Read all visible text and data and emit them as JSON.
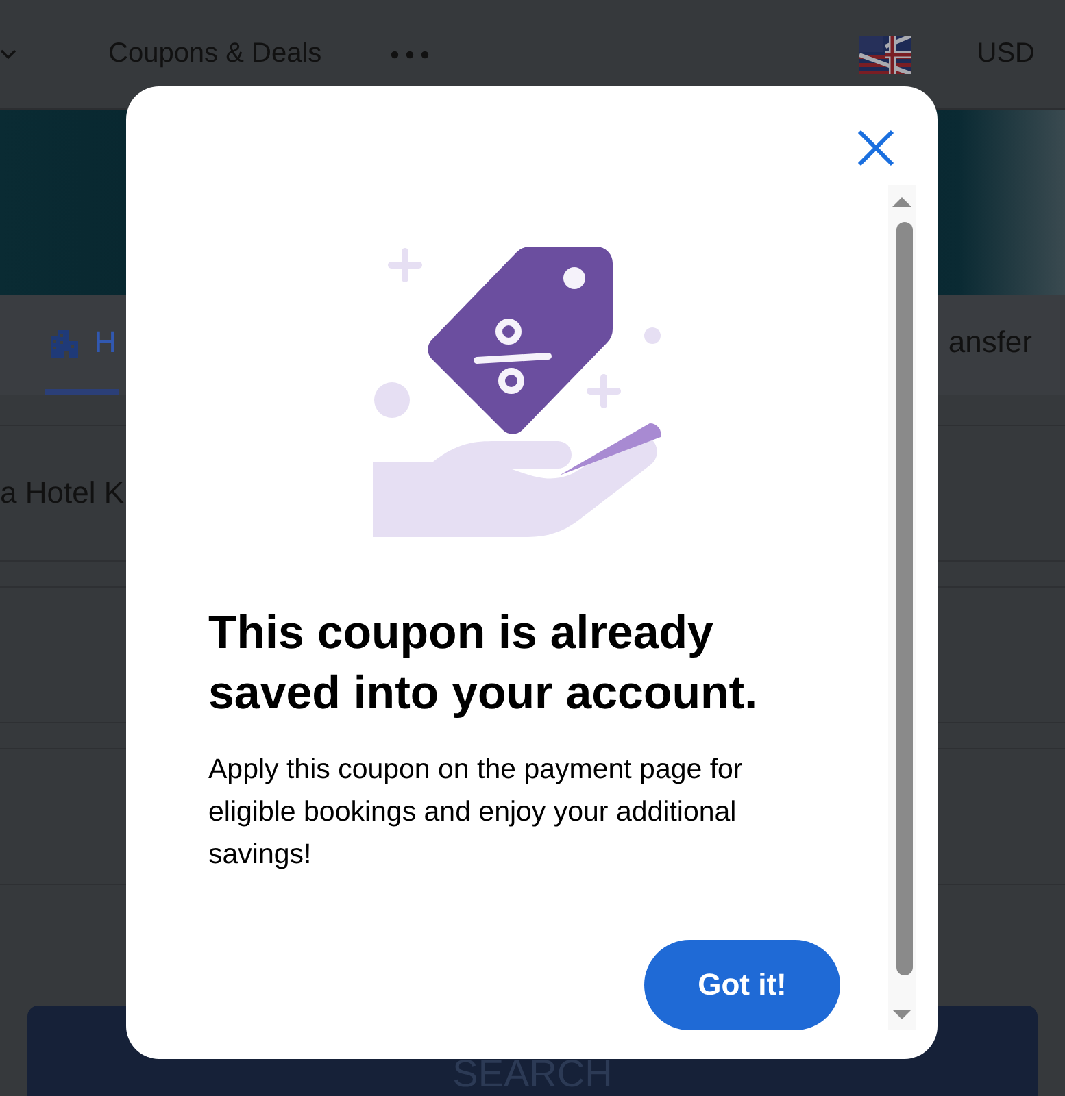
{
  "header": {
    "nav_link": "Coupons & Deals",
    "currency": "USD"
  },
  "tabs": [
    {
      "label": "H",
      "selected": true
    },
    {
      "label": "ansfer",
      "selected": false
    }
  ],
  "form": {
    "destination": "a Hotel K",
    "search_button": "SEARCH"
  },
  "dialog": {
    "title": "This coupon is already saved into your account.",
    "message": "Apply this coupon on the payment page for eligible bookings and enjoy your additional savings!",
    "button": "Got it!"
  }
}
